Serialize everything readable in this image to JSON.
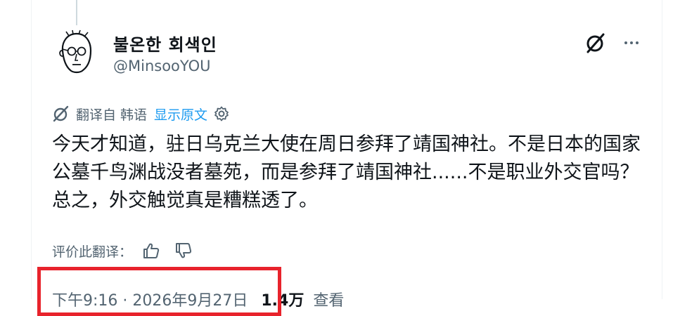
{
  "tweet": {
    "display_name": "불온한 회색인",
    "handle": "@MinsooYOU",
    "translation": {
      "label": "翻译自 韩语",
      "show_original": "显示原文"
    },
    "text": "今天才知道，驻日乌克兰大使在周日参拜了靖国神社。不是日本的国家公墓千鸟渊战没者墓苑，而是参拜了靖国神社......不是职业外交官吗？总之，外交触觉真是糟糕透了。",
    "rate_label": "评价此翻译：",
    "timestamp": "下午9:16 · 2026年9月27日",
    "views_count": "1.4万",
    "views_label": "查看"
  },
  "icons": {
    "grok": "grok-icon",
    "more": "more-icon",
    "translate": "translate-icon",
    "settings": "gear-icon",
    "thumbs_up": "thumbs-up-icon",
    "thumbs_down": "thumbs-down-icon"
  },
  "colors": {
    "text": "#0f1419",
    "secondary": "#536471",
    "link": "#1d9bf0",
    "highlight": "#e8232c"
  }
}
